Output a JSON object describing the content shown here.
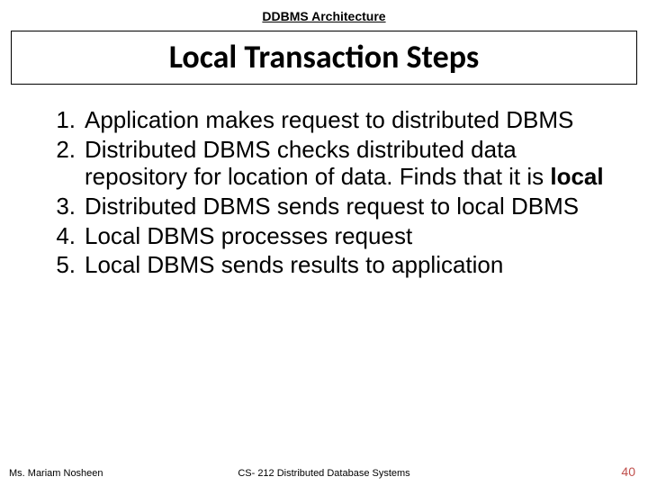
{
  "header": {
    "label": "DDBMS Architecture"
  },
  "title": "Local Transaction Steps",
  "steps": [
    {
      "n": "1.",
      "text": "Application makes request to distributed DBMS"
    },
    {
      "n": "2.",
      "text_pre": "Distributed DBMS checks distributed data repository for location of data. Finds that it is ",
      "text_bold": "local"
    },
    {
      "n": "3.",
      "text": "Distributed DBMS sends request to local DBMS"
    },
    {
      "n": "4.",
      "text": "Local DBMS processes request"
    },
    {
      "n": "5.",
      "text": "Local DBMS sends results to application"
    }
  ],
  "footer": {
    "left": "Ms. Mariam Nosheen",
    "center": "CS- 212 Distributed Database Systems",
    "right": "40"
  }
}
